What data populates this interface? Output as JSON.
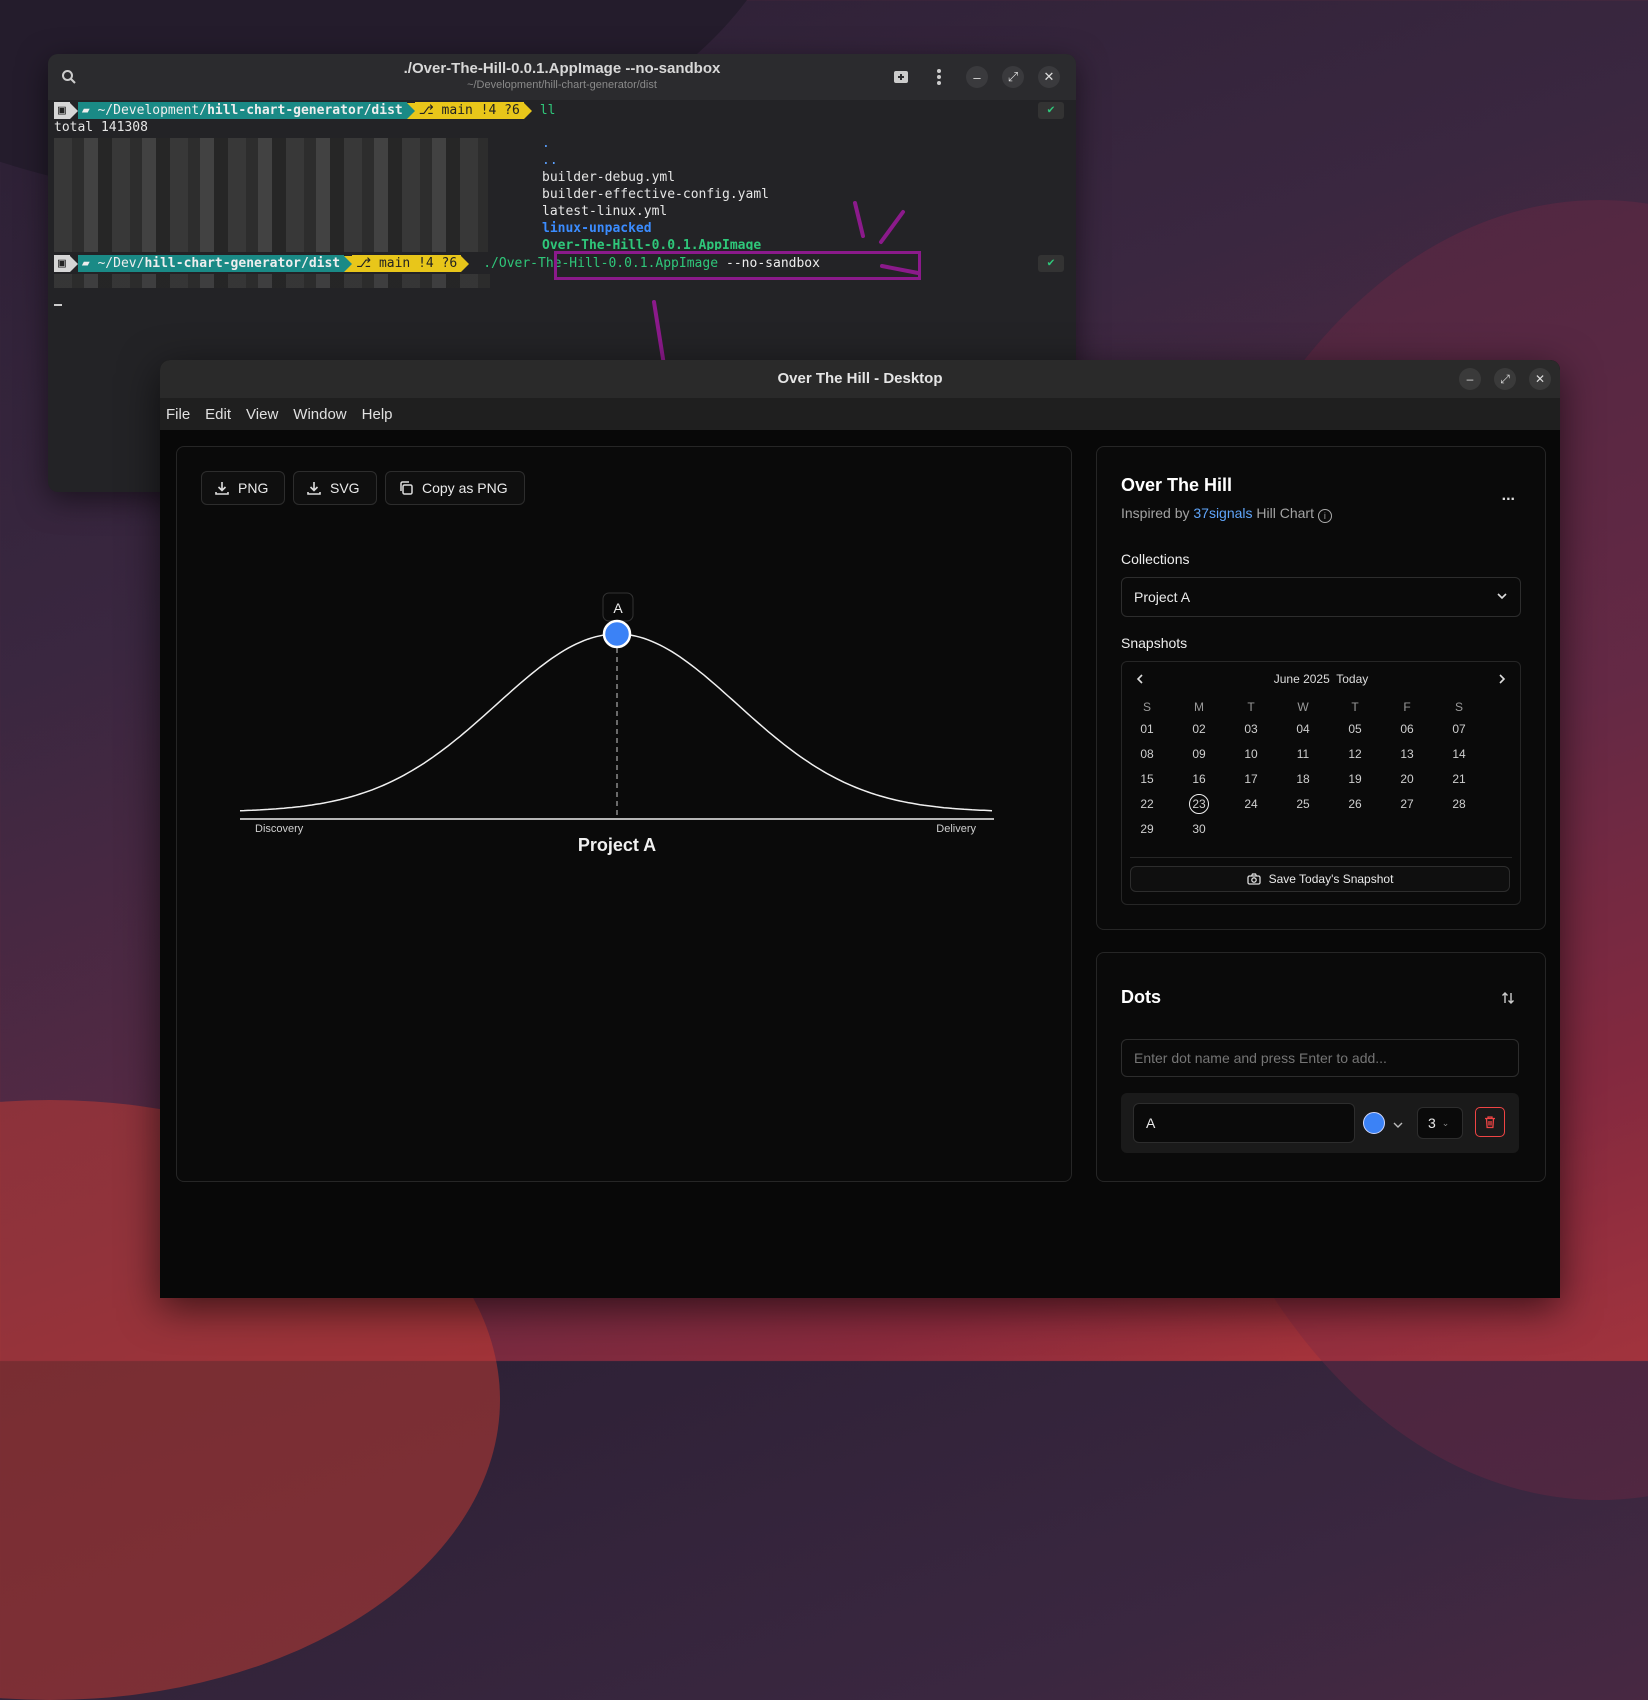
{
  "terminal": {
    "title": "./Over-The-Hill-0.0.1.AppImage --no-sandbox",
    "subtitle": "~/Development/hill-chart-generator/dist",
    "prompt1": {
      "path_prefix": "~/Development/",
      "path_bold": "hill-chart-generator/dist",
      "git": "main !4 ?6",
      "command": "ll"
    },
    "total_line": "total 141308",
    "files": [
      ".",
      "..",
      "builder-debug.yml",
      "builder-effective-config.yaml",
      "latest-linux.yml",
      "linux-unpacked",
      "Over-The-Hill-0.0.1.AppImage"
    ],
    "prompt2": {
      "path_prefix": "~/Dev/",
      "path_bold": "hill-chart-generator/dist",
      "git": "main !4 ?6",
      "command_exec": "./Over-The-Hill-0.0.1.AppImage",
      "command_flag": "--no-sandbox"
    },
    "check_mark": "✔"
  },
  "app": {
    "window_title": "Over The Hill - Desktop",
    "menu": [
      "File",
      "Edit",
      "View",
      "Window",
      "Help"
    ],
    "toolbar": {
      "png": "PNG",
      "svg": "SVG",
      "copy": "Copy as PNG"
    },
    "chart": {
      "dot_label": "A",
      "left_label": "Discovery",
      "right_label": "Delivery",
      "title": "Project A"
    },
    "sidebar": {
      "title": "Over The Hill",
      "inspired_prefix": "Inspired by",
      "inspired_link": "37signals",
      "inspired_suffix": "Hill Chart",
      "more": "...",
      "collections_label": "Collections",
      "collection_value": "Project A",
      "snapshots_label": "Snapshots",
      "calendar": {
        "month": "June 2025",
        "today": "Today",
        "weekdays": [
          "S",
          "M",
          "T",
          "W",
          "T",
          "F",
          "S"
        ],
        "days": [
          "01",
          "02",
          "03",
          "04",
          "05",
          "06",
          "07",
          "08",
          "09",
          "10",
          "11",
          "12",
          "13",
          "14",
          "15",
          "16",
          "17",
          "18",
          "19",
          "20",
          "21",
          "22",
          "23",
          "24",
          "25",
          "26",
          "27",
          "28",
          "29",
          "30"
        ],
        "selected": "23"
      },
      "save_snapshot": "Save Today's Snapshot"
    },
    "dots": {
      "title": "Dots",
      "input_placeholder": "Enter dot name and press Enter to add...",
      "items": [
        {
          "name": "A",
          "color": "#3b82f6",
          "size": "3"
        }
      ]
    }
  },
  "colors": {
    "accent": "#3b82f6",
    "link": "#60a5fa",
    "annotation": "#8b1a8b",
    "delete": "#ef4444"
  }
}
